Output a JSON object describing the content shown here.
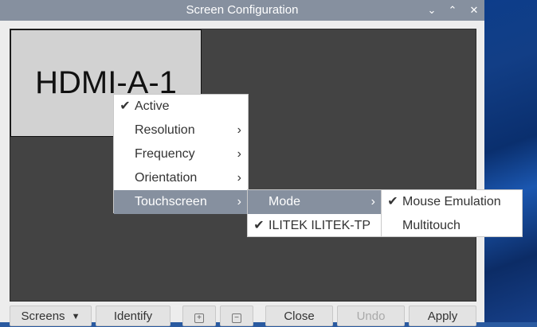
{
  "window": {
    "title": "Screen Configuration",
    "controls": {
      "minimize": "⌄",
      "maximize": "⌃",
      "close": "✕"
    }
  },
  "monitor": {
    "label": "HDMI-A-1"
  },
  "context_menu": {
    "items": [
      {
        "label": "Active",
        "checked": true,
        "submenu": false
      },
      {
        "label": "Resolution",
        "checked": false,
        "submenu": true
      },
      {
        "label": "Frequency",
        "checked": false,
        "submenu": true
      },
      {
        "label": "Orientation",
        "checked": false,
        "submenu": true
      },
      {
        "label": "Touchscreen",
        "checked": false,
        "submenu": true,
        "highlighted": true
      }
    ]
  },
  "touchscreen_menu": {
    "items": [
      {
        "label": "Mode",
        "submenu": true,
        "highlighted": true
      },
      {
        "label": "ILITEK ILITEK-TP",
        "checked": true
      }
    ]
  },
  "mode_menu": {
    "items": [
      {
        "label": "Mouse Emulation",
        "checked": true
      },
      {
        "label": "Multitouch",
        "checked": false
      }
    ]
  },
  "glyphs": {
    "check": "✔",
    "arrow": "›",
    "caret": "▼",
    "zoom_in": "+",
    "zoom_out": "−"
  },
  "toolbar": {
    "screens": "Screens",
    "identify": "Identify",
    "close": "Close",
    "undo": "Undo",
    "apply": "Apply"
  },
  "colors": {
    "titlebar": "#86909f",
    "highlight": "#86909f",
    "canvas": "#434343",
    "monitor": "#d2d2d2"
  }
}
